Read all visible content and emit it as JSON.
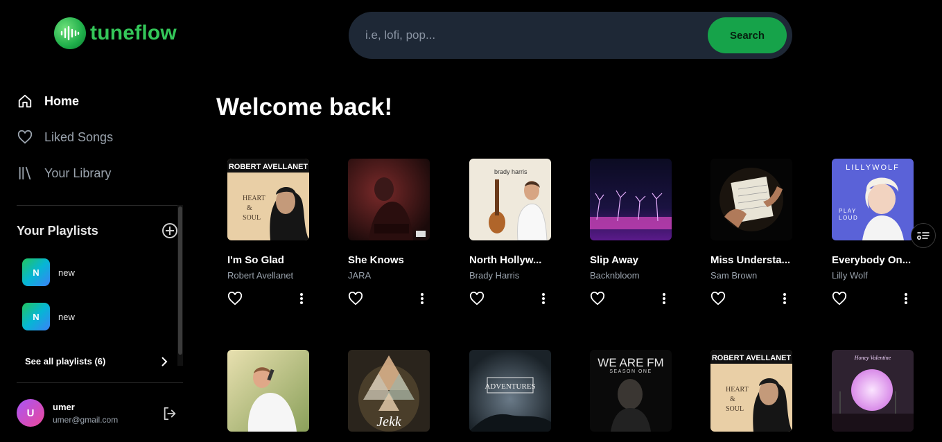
{
  "brand": {
    "name": "tuneflow"
  },
  "nav": [
    {
      "label": "Home",
      "icon": "home-icon"
    },
    {
      "label": "Liked Songs",
      "icon": "heart-icon"
    },
    {
      "label": "Your Library",
      "icon": "library-icon"
    }
  ],
  "playlists": {
    "title": "Your Playlists",
    "items": [
      {
        "initial": "N",
        "name": "new"
      },
      {
        "initial": "N",
        "name": "new"
      }
    ],
    "see_all": "See all playlists (6)"
  },
  "user": {
    "initial": "U",
    "name": "umer",
    "email": "umer@gmail.com"
  },
  "search": {
    "placeholder": "i.e, lofi, pop...",
    "button": "Search"
  },
  "welcome": "Welcome back!",
  "songs": [
    {
      "title": "I'm So Glad",
      "artist": "Robert Avellanet",
      "cover_text": "ROBERT AVELLANET",
      "cover_sub": "HEART & SOUL"
    },
    {
      "title": "She Knows",
      "artist": "JARA"
    },
    {
      "title": "North Hollyw...",
      "artist": "Brady Harris",
      "cover_text": "brady harris"
    },
    {
      "title": "Slip Away",
      "artist": "Backnbloom"
    },
    {
      "title": "Miss Understa...",
      "artist": "Sam Brown"
    },
    {
      "title": "Everybody On...",
      "artist": "Lilly Wolf",
      "cover_text": "LILLYWOLF",
      "cover_sub": "PLAY LOUD"
    }
  ],
  "row2": [
    {
      "cover": "singer"
    },
    {
      "cover_text": "Jekk"
    },
    {
      "cover_text": "ADVENTURES"
    },
    {
      "cover_text": "WE ARE FM",
      "cover_sub": "SEASON ONE"
    },
    {
      "cover_text": "ROBERT AVELLANET",
      "cover_sub": "HEART & SOUL"
    },
    {
      "cover_text": "Honey Valentine"
    }
  ],
  "colors": {
    "accent": "#16a34a",
    "brand": "#34c759",
    "search_bg": "#1e2836"
  }
}
